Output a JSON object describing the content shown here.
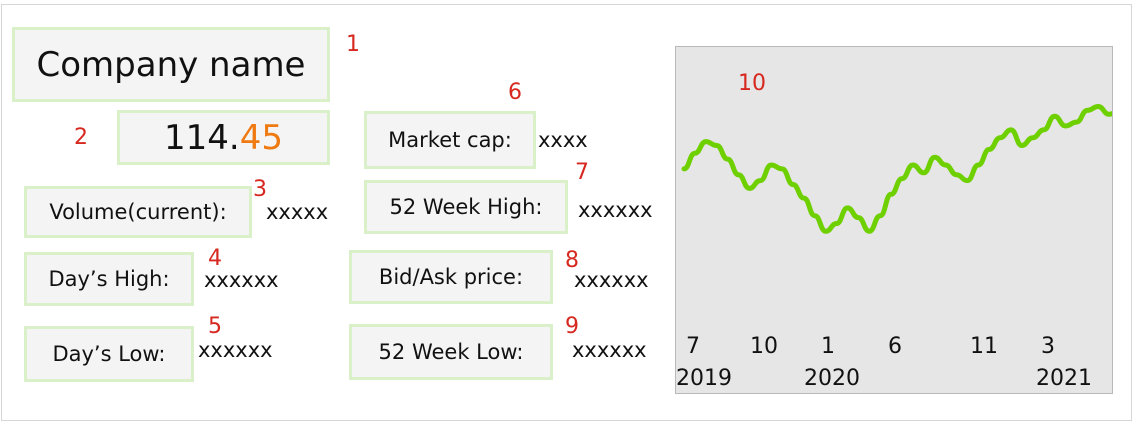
{
  "annotations": {
    "company": "1",
    "price": "2",
    "volume": "3",
    "day_high": "4",
    "day_low": "5",
    "market_cap": "6",
    "week52_high": "7",
    "bid_ask": "8",
    "week52_low": "9",
    "chart": "10"
  },
  "company": {
    "name": "Company name"
  },
  "price": {
    "whole": "114.",
    "decimal": "45",
    "decimal_color": "#f07a12"
  },
  "fields": {
    "volume": {
      "label": "Volume(current):",
      "value": "xxxxx"
    },
    "day_high": {
      "label": "Day’s High:",
      "value": "xxxxxx"
    },
    "day_low": {
      "label": "Day’s Low:",
      "value": "xxxxxx"
    },
    "market_cap": {
      "label": "Market cap:",
      "value": "xxxx"
    },
    "week52_high": {
      "label": "52 Week High:",
      "value": "xxxxxx"
    },
    "bid_ask": {
      "label": "Bid/Ask price:",
      "value": "xxxxxx"
    },
    "week52_low": {
      "label": "52 Week Low:",
      "value": "xxxxxx"
    }
  },
  "colors": {
    "box_border": "#d9f0c9",
    "box_fill": "#f4f4f4",
    "annotation": "#d6281f",
    "line": "#6fd000",
    "chart_bg": "#e6e6e6"
  },
  "chart_data": {
    "type": "line",
    "x_tick_labels": [
      "7",
      "10",
      "1",
      "6",
      "11",
      "3"
    ],
    "x_year_labels": [
      "2019",
      "2020",
      "2021"
    ],
    "line_color": "#6fd000",
    "y_values": [
      0.58,
      0.66,
      0.72,
      0.7,
      0.63,
      0.55,
      0.48,
      0.52,
      0.6,
      0.58,
      0.5,
      0.43,
      0.34,
      0.26,
      0.3,
      0.38,
      0.33,
      0.26,
      0.34,
      0.45,
      0.53,
      0.6,
      0.56,
      0.64,
      0.6,
      0.55,
      0.52,
      0.6,
      0.68,
      0.74,
      0.78,
      0.7,
      0.74,
      0.78,
      0.85,
      0.8,
      0.82,
      0.88,
      0.9,
      0.86,
      0.88
    ]
  }
}
